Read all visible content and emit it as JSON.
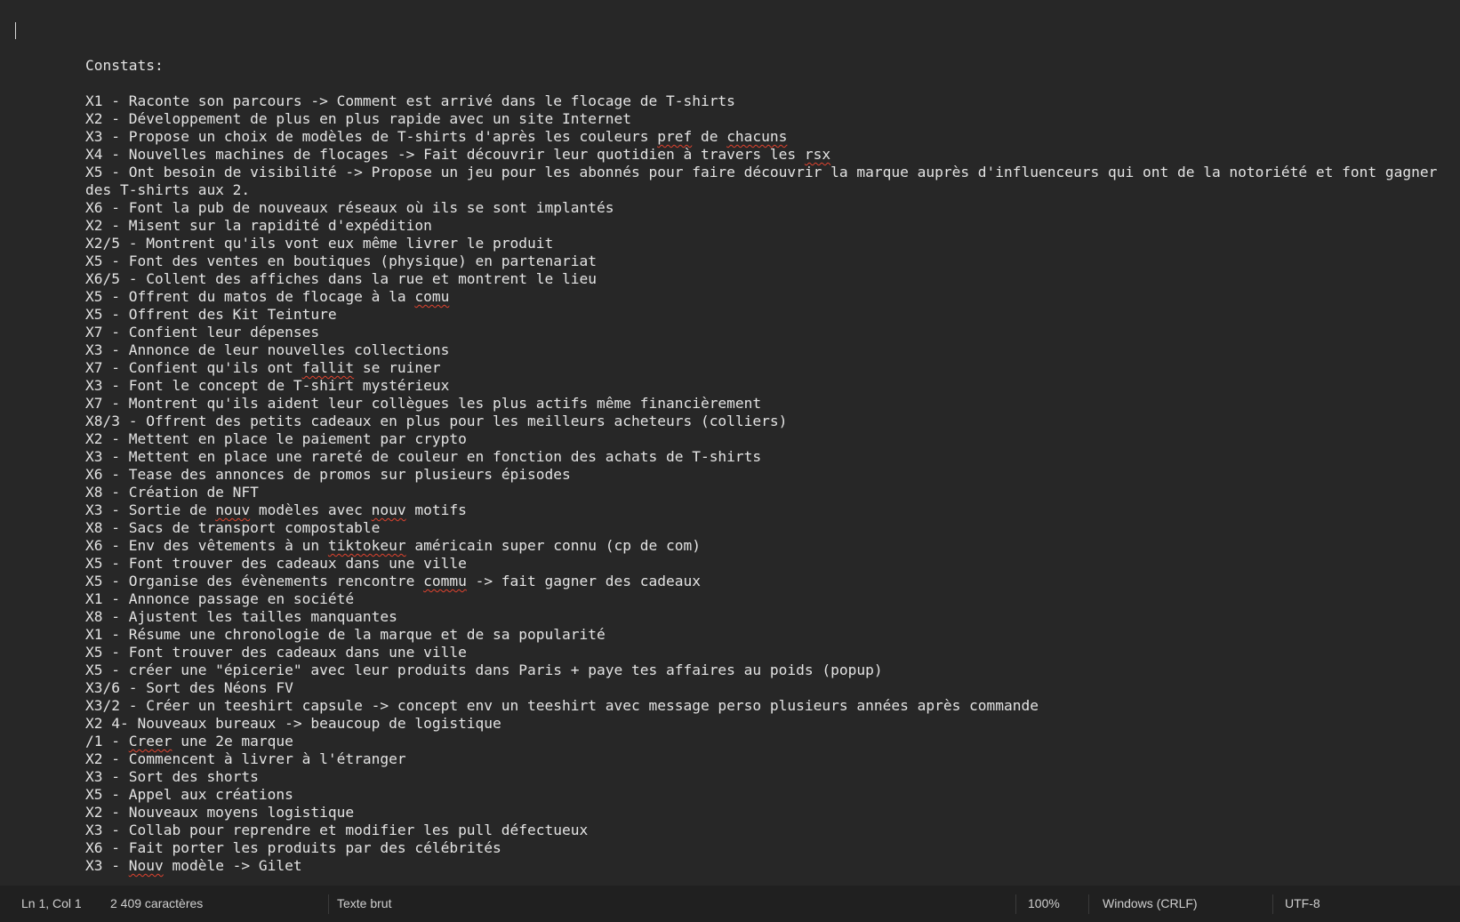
{
  "editor": {
    "lines": [
      [
        {
          "t": ""
        }
      ],
      [
        {
          "t": "Constats:"
        }
      ],
      [
        {
          "t": ""
        }
      ],
      [
        {
          "t": "X1 - Raconte son parcours -> Comment est arrivé dans le flocage de T-shirts"
        }
      ],
      [
        {
          "t": "X2 - Développement de plus en plus rapide avec un site Internet"
        }
      ],
      [
        {
          "t": "X3 - Propose un choix de modèles de T-shirts d'après les couleurs "
        },
        {
          "t": "pref",
          "spell": true
        },
        {
          "t": " de "
        },
        {
          "t": "chacuns",
          "spell": true
        }
      ],
      [
        {
          "t": "X4 - Nouvelles machines de flocages -> Fait découvrir leur quotidien à travers les "
        },
        {
          "t": "rsx",
          "spell": true
        }
      ],
      [
        {
          "t": "X5 - Ont besoin de visibilité -> Propose un jeu pour les abonnés pour faire découvrir la marque auprès d'influenceurs qui ont de la notoriété et font gagner des T-shirts aux 2."
        }
      ],
      [
        {
          "t": "X6 - Font la pub de nouveaux réseaux où ils se sont implantés"
        }
      ],
      [
        {
          "t": "X2 - Misent sur la rapidité d'expédition"
        }
      ],
      [
        {
          "t": "X2/5 - Montrent qu'ils vont eux même livrer le produit"
        }
      ],
      [
        {
          "t": "X5 - Font des ventes en boutiques (physique) en partenariat"
        }
      ],
      [
        {
          "t": "X6/5 - Collent des affiches dans la rue et montrent le lieu"
        }
      ],
      [
        {
          "t": "X5 - Offrent du matos de flocage à la "
        },
        {
          "t": "comu",
          "spell": true
        }
      ],
      [
        {
          "t": "X5 - Offrent des Kit Teinture"
        }
      ],
      [
        {
          "t": "X7 - Confient leur dépenses"
        }
      ],
      [
        {
          "t": "X3 - Annonce de leur nouvelles collections"
        }
      ],
      [
        {
          "t": "X7 - Confient qu'ils ont "
        },
        {
          "t": "fallit",
          "spell": true
        },
        {
          "t": " se ruiner"
        }
      ],
      [
        {
          "t": "X3 - Font le concept de T-shirt mystérieux"
        }
      ],
      [
        {
          "t": "X7 - Montrent qu'ils aident leur collègues les plus actifs même financièrement"
        }
      ],
      [
        {
          "t": "X8/3 - Offrent des petits cadeaux en plus pour les meilleurs acheteurs (colliers)"
        }
      ],
      [
        {
          "t": "X2 - Mettent en place le paiement par crypto"
        }
      ],
      [
        {
          "t": "X3 - Mettent en place une rareté de couleur en fonction des achats de T-shirts"
        }
      ],
      [
        {
          "t": "X6 - Tease des annonces de promos sur plusieurs épisodes"
        }
      ],
      [
        {
          "t": "X8 - Création de NFT"
        }
      ],
      [
        {
          "t": "X3 - Sortie de "
        },
        {
          "t": "nouv",
          "spell": true
        },
        {
          "t": " modèles avec "
        },
        {
          "t": "nouv",
          "spell": true
        },
        {
          "t": " motifs"
        }
      ],
      [
        {
          "t": "X8 - Sacs de transport compostable"
        }
      ],
      [
        {
          "t": "X6 - Env des vêtements à un "
        },
        {
          "t": "tiktokeur",
          "spell": true
        },
        {
          "t": " américain super connu (cp de com)"
        }
      ],
      [
        {
          "t": "X5 - Font trouver des cadeaux dans une ville"
        }
      ],
      [
        {
          "t": "X5 - Organise des évènements rencontre "
        },
        {
          "t": "commu",
          "spell": true
        },
        {
          "t": " -> fait gagner des cadeaux"
        }
      ],
      [
        {
          "t": "X1 - Annonce passage en société"
        }
      ],
      [
        {
          "t": "X8 - Ajustent les tailles manquantes"
        }
      ],
      [
        {
          "t": "X1 - Résume une chronologie de la marque et de sa popularité"
        }
      ],
      [
        {
          "t": "X5 - Font trouver des cadeaux dans une ville"
        }
      ],
      [
        {
          "t": "X5 - créer une \"épicerie\" avec leur produits dans Paris + paye tes affaires au poids (popup)"
        }
      ],
      [
        {
          "t": "X3/6 - Sort des Néons FV"
        }
      ],
      [
        {
          "t": "X3/2 - Créer un teeshirt capsule -> concept env un teeshirt avec message perso plusieurs années après commande"
        }
      ],
      [
        {
          "t": "X2 4- Nouveaux bureaux -> beaucoup de logistique"
        }
      ],
      [
        {
          "t": "/1 - "
        },
        {
          "t": "Creer",
          "spell": true
        },
        {
          "t": " une 2e marque"
        }
      ],
      [
        {
          "t": "X2 - Commencent à livrer à l'étranger"
        }
      ],
      [
        {
          "t": "X3 - Sort des shorts"
        }
      ],
      [
        {
          "t": "X5 - Appel aux créations"
        }
      ],
      [
        {
          "t": "X2 - Nouveaux moyens logistique"
        }
      ],
      [
        {
          "t": "X3 - Collab pour reprendre et modifier les pull défectueux"
        }
      ],
      [
        {
          "t": "X6 - Fait porter les produits par des célébrités"
        }
      ],
      [
        {
          "t": "X3 - "
        },
        {
          "t": "Nouv",
          "spell": true
        },
        {
          "t": " modèle -> Gilet"
        }
      ]
    ]
  },
  "statusbar": {
    "cursor_position": "Ln 1, Col 1",
    "char_count": "2 409 caractères",
    "format": "Texte brut",
    "zoom": "100%",
    "line_ending": "Windows (CRLF)",
    "encoding": "UTF-8"
  },
  "colors": {
    "editor_background": "#272727",
    "statusbar_background": "#202020",
    "text": "#e3e3e3",
    "spellcheck_underline": "#e0432f"
  }
}
